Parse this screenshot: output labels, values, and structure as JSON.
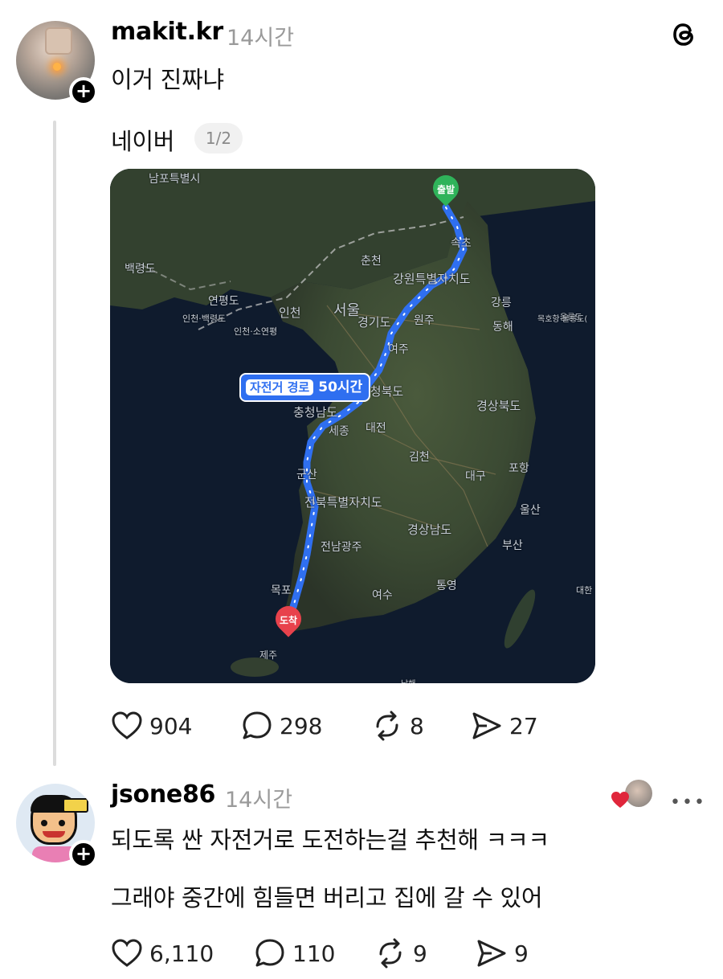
{
  "app_icon": "threads-logo-icon",
  "posts": [
    {
      "username": "makit.kr",
      "time": "14시간",
      "lines": [
        "이거 진짜냐"
      ],
      "reply_line": "네이버",
      "pager": "1/2",
      "map": {
        "start_label": "출발",
        "end_label": "도착",
        "route_name": "자전거 경로",
        "route_time": "50시간",
        "places": [
          "남포특별시",
          "백령도",
          "연평도",
          "인천·백령도",
          "인천·소연평",
          "인천",
          "서울",
          "춘천",
          "강원특별자치도",
          "강릉",
          "동해",
          "원주",
          "속초",
          "여주",
          "충청북도",
          "충청남도",
          "세종",
          "대전",
          "김천",
          "경상북도",
          "대구",
          "포항",
          "울산",
          "부산",
          "경상남도",
          "통영",
          "여수",
          "전북특별자치도",
          "군산",
          "전남광주",
          "목포",
          "제주",
          "울릉도",
          "대한",
          "경기도",
          "목호항·울릉도(",
          "남해"
        ]
      },
      "stats": {
        "likes": "904",
        "comments": "298",
        "reposts": "8",
        "shares": "27"
      }
    },
    {
      "username": "jsone86",
      "time": "14시간",
      "lines": [
        "되도록 싼 자전거로 도전하는걸 추천해 ㅋㅋㅋ",
        "그래야 중간에 힘들면 버리고 집에 갈 수 있어"
      ],
      "stats": {
        "likes": "6,110",
        "comments": "110",
        "reposts": "9",
        "shares": "9"
      }
    }
  ],
  "colors": {
    "route": "#3b7bff",
    "start_pin": "#2fb35a",
    "end_pin": "#e8424c",
    "like_heart": "#e0263b"
  }
}
